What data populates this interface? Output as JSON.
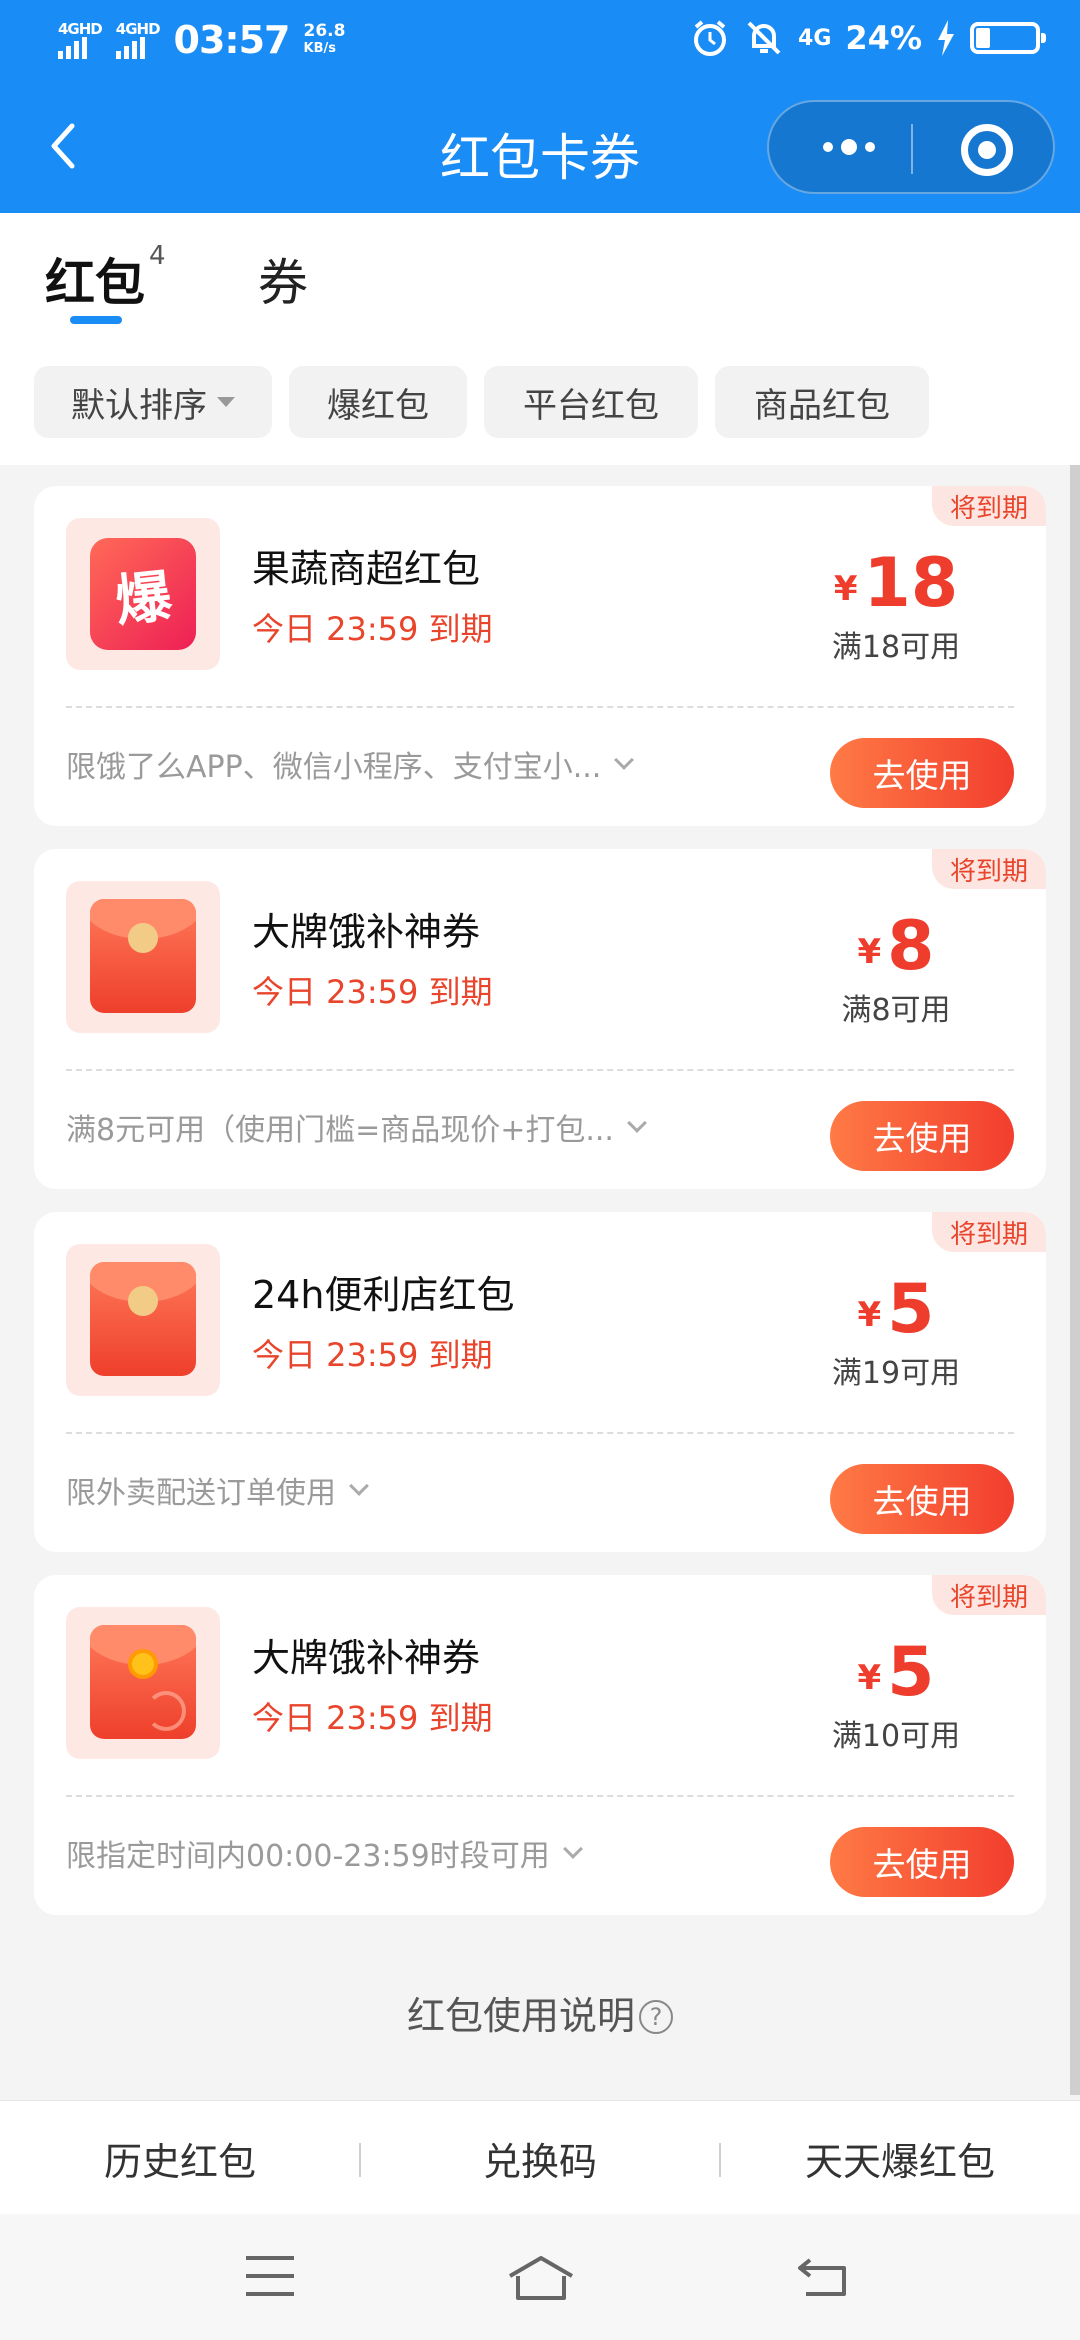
{
  "status_bar": {
    "network_1": "4GHD",
    "network_2": "4GHD",
    "time": "03:57",
    "speed_value": "26.8",
    "speed_unit": "KB/s",
    "net_type": "4G",
    "battery": "24%"
  },
  "nav": {
    "title": "红包卡券"
  },
  "tabs": [
    {
      "label": "红包",
      "count": "4"
    },
    {
      "label": "券"
    }
  ],
  "filters": [
    {
      "label": "默认排序"
    },
    {
      "label": "爆红包"
    },
    {
      "label": "平台红包"
    },
    {
      "label": "商品红包"
    }
  ],
  "cards": [
    {
      "badge": "将到期",
      "icon": "bao-icon",
      "icon_text": "爆",
      "title": "果蔬商超红包",
      "expiry": "今日 23:59 到期",
      "currency": "¥",
      "amount": "18",
      "condition": "满18可用",
      "note": "限饿了么APP、微信小程序、支付宝小...",
      "button": "去使用"
    },
    {
      "badge": "将到期",
      "icon": "red-envelope-icon",
      "title": "大牌饿补神券",
      "expiry": "今日 23:59 到期",
      "currency": "¥",
      "amount": "8",
      "condition": "满8可用",
      "note": "满8元可用（使用门槛=商品现价+打包...",
      "button": "去使用"
    },
    {
      "badge": "将到期",
      "icon": "red-envelope-icon",
      "title": "24h便利店红包",
      "expiry": "今日 23:59 到期",
      "currency": "¥",
      "amount": "5",
      "condition": "满19可用",
      "note": "限外卖配送订单使用",
      "button": "去使用"
    },
    {
      "badge": "将到期",
      "icon": "gold-envelope-icon",
      "title": "大牌饿补神券",
      "expiry": "今日 23:59 到期",
      "currency": "¥",
      "amount": "5",
      "condition": "满10可用",
      "note": "限指定时间内00:00-23:59时段可用",
      "button": "去使用"
    }
  ],
  "help": {
    "label": "红包使用说明",
    "icon": "?"
  },
  "bottom_bar": [
    {
      "label": "历史红包"
    },
    {
      "label": "兑换码"
    },
    {
      "label": "天天爆红包"
    }
  ],
  "colors": {
    "primary_blue": "#1a8cf5",
    "accent_red": "#ee3d2c",
    "button_gradient_start": "#ff7a45",
    "button_gradient_end": "#f23e2e"
  }
}
